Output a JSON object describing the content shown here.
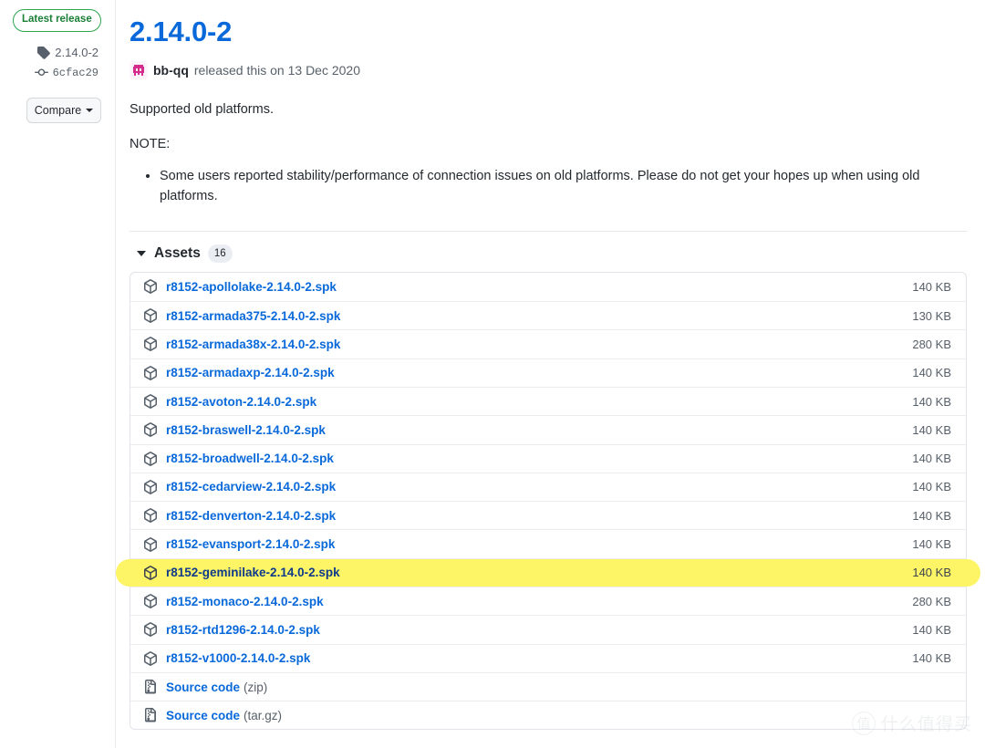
{
  "sidebar": {
    "latest_badge": "Latest release",
    "tag_icon": "tag-icon",
    "tag_name": "2.14.0-2",
    "commit_icon": "commit-icon",
    "commit_sha": "6cfac29",
    "compare_label": "Compare"
  },
  "release": {
    "title": "2.14.0-2",
    "author": "bb-qq",
    "byline_rest": "released this on 13 Dec 2020",
    "paragraph_1": "Supported old platforms.",
    "paragraph_2": "NOTE:",
    "notes": [
      "Some users reported stability/performance of connection issues on old platforms. Please do not get your hopes up when using old platforms."
    ]
  },
  "assets": {
    "label": "Assets",
    "count": "16",
    "rows": [
      {
        "icon": "package-icon",
        "name": "r8152-apollolake-2.14.0-2.spk",
        "suffix": "",
        "size": "140 KB",
        "highlighted": false
      },
      {
        "icon": "package-icon",
        "name": "r8152-armada375-2.14.0-2.spk",
        "suffix": "",
        "size": "130 KB",
        "highlighted": false
      },
      {
        "icon": "package-icon",
        "name": "r8152-armada38x-2.14.0-2.spk",
        "suffix": "",
        "size": "280 KB",
        "highlighted": false
      },
      {
        "icon": "package-icon",
        "name": "r8152-armadaxp-2.14.0-2.spk",
        "suffix": "",
        "size": "140 KB",
        "highlighted": false
      },
      {
        "icon": "package-icon",
        "name": "r8152-avoton-2.14.0-2.spk",
        "suffix": "",
        "size": "140 KB",
        "highlighted": false
      },
      {
        "icon": "package-icon",
        "name": "r8152-braswell-2.14.0-2.spk",
        "suffix": "",
        "size": "140 KB",
        "highlighted": false
      },
      {
        "icon": "package-icon",
        "name": "r8152-broadwell-2.14.0-2.spk",
        "suffix": "",
        "size": "140 KB",
        "highlighted": false
      },
      {
        "icon": "package-icon",
        "name": "r8152-cedarview-2.14.0-2.spk",
        "suffix": "",
        "size": "140 KB",
        "highlighted": false
      },
      {
        "icon": "package-icon",
        "name": "r8152-denverton-2.14.0-2.spk",
        "suffix": "",
        "size": "140 KB",
        "highlighted": false
      },
      {
        "icon": "package-icon",
        "name": "r8152-evansport-2.14.0-2.spk",
        "suffix": "",
        "size": "140 KB",
        "highlighted": false
      },
      {
        "icon": "package-icon",
        "name": "r8152-geminilake-2.14.0-2.spk",
        "suffix": "",
        "size": "140 KB",
        "highlighted": true
      },
      {
        "icon": "package-icon",
        "name": "r8152-monaco-2.14.0-2.spk",
        "suffix": "",
        "size": "280 KB",
        "highlighted": false
      },
      {
        "icon": "package-icon",
        "name": "r8152-rtd1296-2.14.0-2.spk",
        "suffix": "",
        "size": "140 KB",
        "highlighted": false
      },
      {
        "icon": "package-icon",
        "name": "r8152-v1000-2.14.0-2.spk",
        "suffix": "",
        "size": "140 KB",
        "highlighted": false
      },
      {
        "icon": "file-zip-icon",
        "name": "Source code",
        "suffix": "(zip)",
        "size": "",
        "highlighted": false
      },
      {
        "icon": "file-zip-icon",
        "name": "Source code",
        "suffix": "(tar.gz)",
        "size": "",
        "highlighted": false
      }
    ]
  },
  "watermark": {
    "mark": "值",
    "text": "什么值得买"
  },
  "colors": {
    "link": "#0969da",
    "green": "#1a7f37",
    "muted": "#57606a",
    "highlight": "#fdf566"
  }
}
